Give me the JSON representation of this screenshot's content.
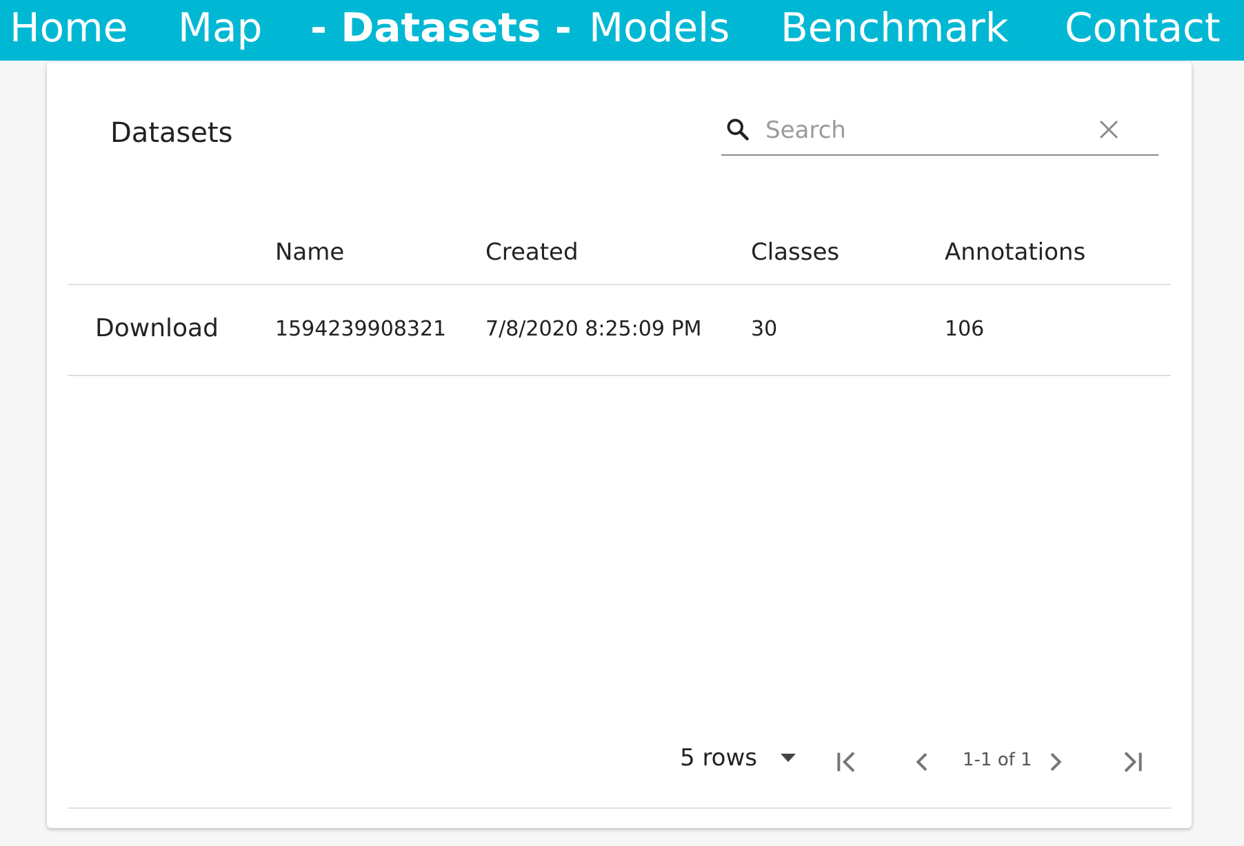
{
  "nav": {
    "items": [
      {
        "label": "Home"
      },
      {
        "label": "Map"
      },
      {
        "label": "- Datasets -"
      },
      {
        "label": "Models"
      },
      {
        "label": "Benchmark"
      },
      {
        "label": "Contact"
      }
    ],
    "active_index": 2,
    "color": "#00b8d4"
  },
  "card": {
    "title": "Datasets"
  },
  "search": {
    "placeholder": "Search",
    "value": ""
  },
  "table": {
    "columns": [
      "",
      "Name",
      "Created",
      "Classes",
      "Annotations"
    ],
    "rows": [
      {
        "action": "Download",
        "name": "1594239908321",
        "created": "7/8/2020 8:25:09 PM",
        "classes": "30",
        "annotations": "106"
      }
    ]
  },
  "pagination": {
    "rows_per_page_label": "5 rows",
    "range_label": "1-1 of 1"
  }
}
